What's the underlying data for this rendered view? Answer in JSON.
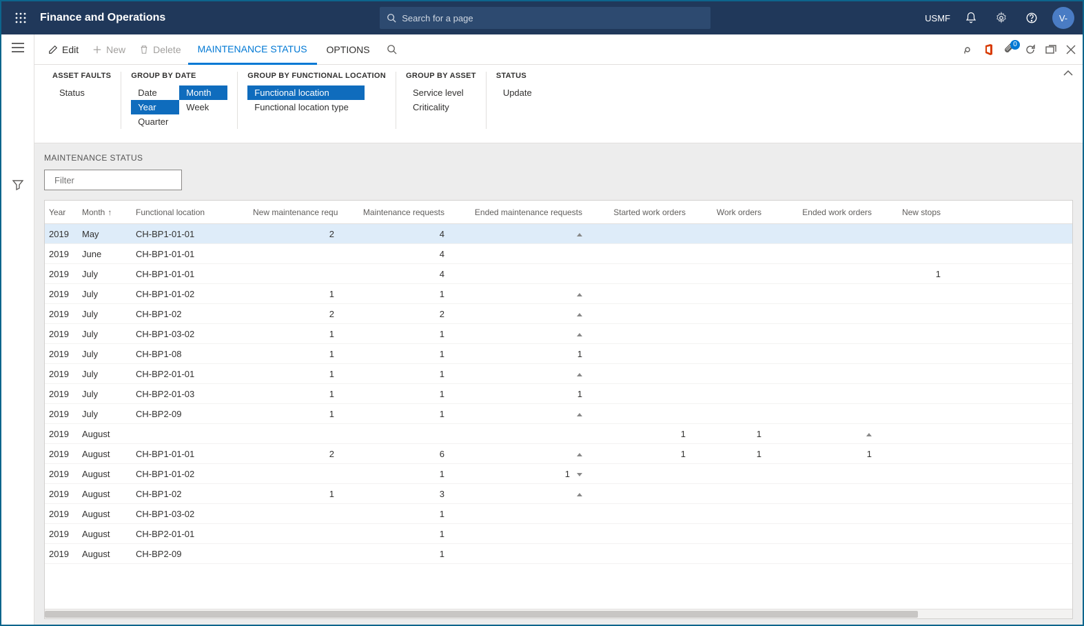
{
  "topbar": {
    "app_title": "Finance and Operations",
    "search_placeholder": "Search for a page",
    "entity": "USMF",
    "avatar_initials": "V-"
  },
  "actionbar": {
    "edit": "Edit",
    "new": "New",
    "delete": "Delete",
    "tab_maintenance_status": "MAINTENANCE STATUS",
    "tab_options": "OPTIONS",
    "badge_count": "0"
  },
  "groups": {
    "asset_faults": {
      "title": "ASSET FAULTS",
      "items": [
        "Status"
      ]
    },
    "group_by_date": {
      "title": "GROUP BY DATE",
      "col1": [
        "Date",
        "Year",
        "Quarter"
      ],
      "col2": [
        "Month",
        "Week",
        ""
      ]
    },
    "group_by_funcloc": {
      "title": "GROUP BY FUNCTIONAL LOCATION",
      "items": [
        "Functional location",
        "Functional location type"
      ]
    },
    "group_by_asset": {
      "title": "GROUP BY ASSET",
      "items": [
        "Service level",
        "Criticality"
      ]
    },
    "status": {
      "title": "STATUS",
      "items": [
        "Update"
      ]
    }
  },
  "content": {
    "heading": "MAINTENANCE STATUS",
    "filter_placeholder": "Filter"
  },
  "grid": {
    "columns": [
      "Year",
      "Month",
      "Functional location",
      "New maintenance requests",
      "Maintenance requests",
      "Ended maintenance requests",
      "Started work orders",
      "Work orders",
      "Ended work orders",
      "New stops"
    ],
    "sort_col": 1,
    "rows": [
      {
        "year": "2019",
        "month": "May",
        "loc": "CH-BP1-01-01",
        "nmr": "2",
        "mr": "4",
        "emr": "",
        "emr_tri": "up",
        "swo": "",
        "wo": "",
        "ewo": "",
        "ewo_tri": "",
        "ns": "",
        "sel": true
      },
      {
        "year": "2019",
        "month": "June",
        "loc": "CH-BP1-01-01",
        "nmr": "",
        "mr": "4",
        "emr": "",
        "emr_tri": "",
        "swo": "",
        "wo": "",
        "ewo": "",
        "ewo_tri": "",
        "ns": ""
      },
      {
        "year": "2019",
        "month": "July",
        "loc": "CH-BP1-01-01",
        "nmr": "",
        "mr": "4",
        "emr": "",
        "emr_tri": "",
        "swo": "",
        "wo": "",
        "ewo": "",
        "ewo_tri": "",
        "ns": "1"
      },
      {
        "year": "2019",
        "month": "July",
        "loc": "CH-BP1-01-02",
        "nmr": "1",
        "mr": "1",
        "emr": "",
        "emr_tri": "up",
        "swo": "",
        "wo": "",
        "ewo": "",
        "ewo_tri": "",
        "ns": ""
      },
      {
        "year": "2019",
        "month": "July",
        "loc": "CH-BP1-02",
        "nmr": "2",
        "mr": "2",
        "emr": "",
        "emr_tri": "up",
        "swo": "",
        "wo": "",
        "ewo": "",
        "ewo_tri": "",
        "ns": ""
      },
      {
        "year": "2019",
        "month": "July",
        "loc": "CH-BP1-03-02",
        "nmr": "1",
        "mr": "1",
        "emr": "",
        "emr_tri": "up",
        "swo": "",
        "wo": "",
        "ewo": "",
        "ewo_tri": "",
        "ns": ""
      },
      {
        "year": "2019",
        "month": "July",
        "loc": "CH-BP1-08",
        "nmr": "1",
        "mr": "1",
        "emr": "1",
        "emr_tri": "",
        "swo": "",
        "wo": "",
        "ewo": "",
        "ewo_tri": "",
        "ns": ""
      },
      {
        "year": "2019",
        "month": "July",
        "loc": "CH-BP2-01-01",
        "nmr": "1",
        "mr": "1",
        "emr": "",
        "emr_tri": "up",
        "swo": "",
        "wo": "",
        "ewo": "",
        "ewo_tri": "",
        "ns": ""
      },
      {
        "year": "2019",
        "month": "July",
        "loc": "CH-BP2-01-03",
        "nmr": "1",
        "mr": "1",
        "emr": "1",
        "emr_tri": "",
        "swo": "",
        "wo": "",
        "ewo": "",
        "ewo_tri": "",
        "ns": ""
      },
      {
        "year": "2019",
        "month": "July",
        "loc": "CH-BP2-09",
        "nmr": "1",
        "mr": "1",
        "emr": "",
        "emr_tri": "up",
        "swo": "",
        "wo": "",
        "ewo": "",
        "ewo_tri": "",
        "ns": ""
      },
      {
        "year": "2019",
        "month": "August",
        "loc": "",
        "nmr": "",
        "mr": "",
        "emr": "",
        "emr_tri": "",
        "swo": "1",
        "wo": "1",
        "ewo": "",
        "ewo_tri": "up",
        "ns": ""
      },
      {
        "year": "2019",
        "month": "August",
        "loc": "CH-BP1-01-01",
        "nmr": "2",
        "mr": "6",
        "emr": "",
        "emr_tri": "up",
        "swo": "1",
        "wo": "1",
        "ewo": "1",
        "ewo_tri": "",
        "ns": ""
      },
      {
        "year": "2019",
        "month": "August",
        "loc": "CH-BP1-01-02",
        "nmr": "",
        "mr": "1",
        "emr": "1",
        "emr_tri": "dn",
        "swo": "",
        "wo": "",
        "ewo": "",
        "ewo_tri": "",
        "ns": ""
      },
      {
        "year": "2019",
        "month": "August",
        "loc": "CH-BP1-02",
        "nmr": "1",
        "mr": "3",
        "emr": "",
        "emr_tri": "up",
        "swo": "",
        "wo": "",
        "ewo": "",
        "ewo_tri": "",
        "ns": ""
      },
      {
        "year": "2019",
        "month": "August",
        "loc": "CH-BP1-03-02",
        "nmr": "",
        "mr": "1",
        "emr": "",
        "emr_tri": "",
        "swo": "",
        "wo": "",
        "ewo": "",
        "ewo_tri": "",
        "ns": ""
      },
      {
        "year": "2019",
        "month": "August",
        "loc": "CH-BP2-01-01",
        "nmr": "",
        "mr": "1",
        "emr": "",
        "emr_tri": "",
        "swo": "",
        "wo": "",
        "ewo": "",
        "ewo_tri": "",
        "ns": ""
      },
      {
        "year": "2019",
        "month": "August",
        "loc": "CH-BP2-09",
        "nmr": "",
        "mr": "1",
        "emr": "",
        "emr_tri": "",
        "swo": "",
        "wo": "",
        "ewo": "",
        "ewo_tri": "",
        "ns": ""
      }
    ]
  }
}
